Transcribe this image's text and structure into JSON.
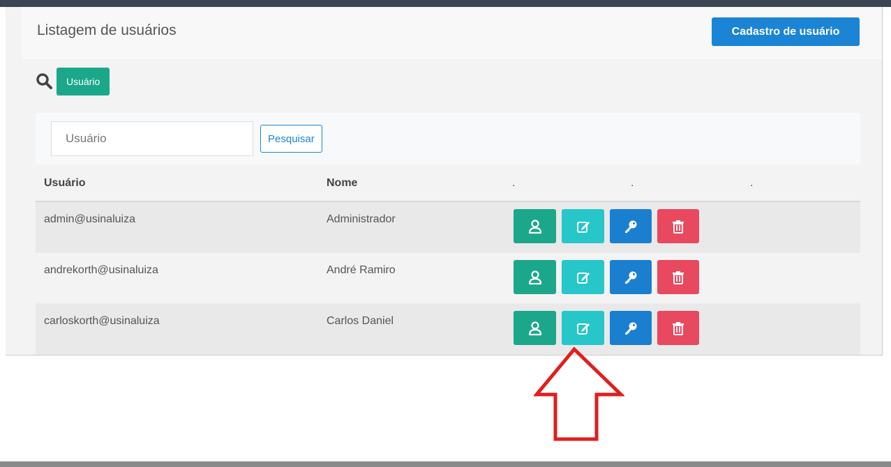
{
  "header": {
    "title": "Listagem de usuários",
    "cadastro_label": "Cadastro de usuário"
  },
  "search": {
    "icon": "search-icon",
    "badge_label": "Usuário",
    "placeholder": "Usuário",
    "value": "",
    "button_label": "Pesquisar"
  },
  "table": {
    "columns": [
      "Usuário",
      "Nome",
      ".",
      ".",
      "."
    ],
    "rows": [
      {
        "usuario": "admin@usinaluiza",
        "nome": "Administrador"
      },
      {
        "usuario": "andrekorth@usinaluiza",
        "nome": "André Ramiro"
      },
      {
        "usuario": "carloskorth@usinaluiza",
        "nome": "Carlos Daniel"
      }
    ],
    "action_icons": [
      "user-icon",
      "edit-icon",
      "key-icon",
      "trash-icon"
    ]
  },
  "colors": {
    "accent_blue": "#1b84d4",
    "green": "#1ba78a",
    "cyan": "#26c6c9",
    "red": "#e8495f",
    "annotation_arrow": "#e01e1e"
  },
  "annotation": {
    "icon": "up-arrow-icon"
  }
}
